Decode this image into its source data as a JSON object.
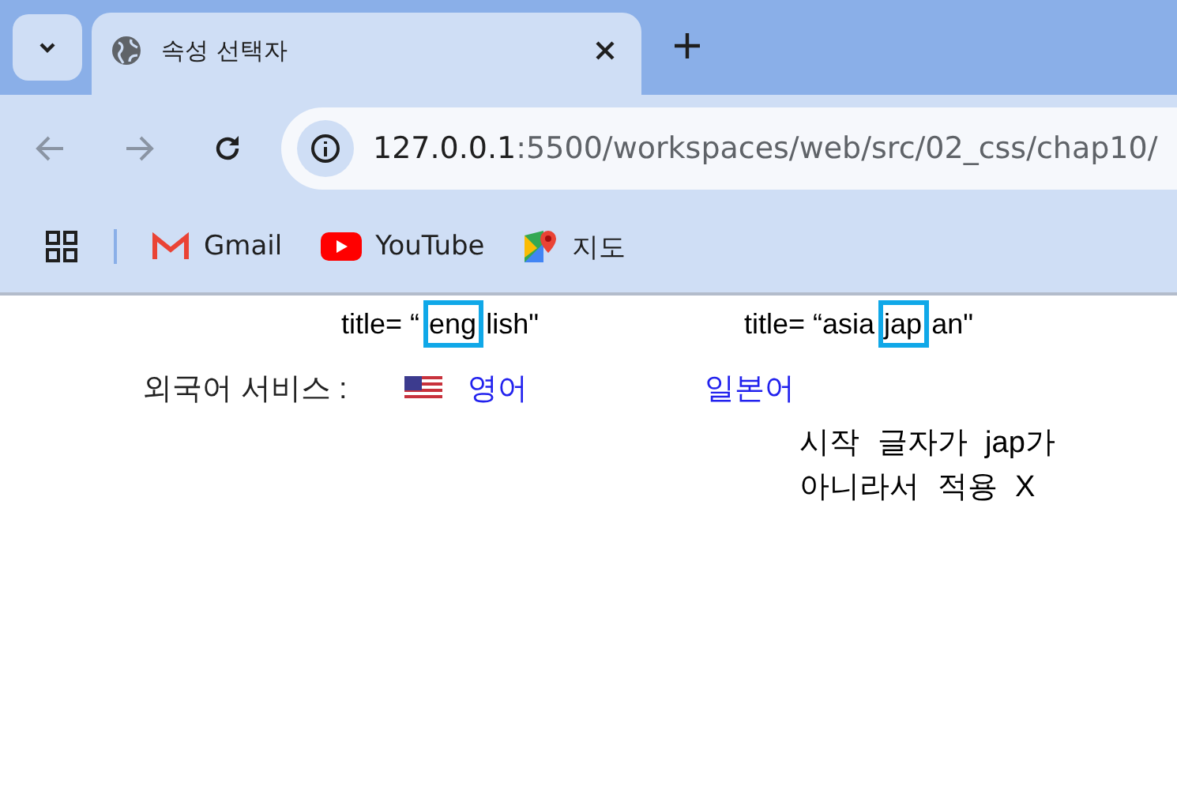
{
  "tab": {
    "title": "속성 선택자"
  },
  "address_bar": {
    "host": "127.0.0.1",
    "path": ":5500/workspaces/web/src/02_css/chap10/"
  },
  "bookmarks": [
    {
      "label": "Gmail",
      "kind": "gmail"
    },
    {
      "label": "YouTube",
      "kind": "youtube"
    },
    {
      "label": "지도",
      "kind": "maps"
    }
  ],
  "page": {
    "label": "외국어 서비스 :",
    "links": [
      {
        "label": "영어",
        "flag": true
      },
      {
        "label": "일본어",
        "flag": false
      }
    ]
  },
  "annotations": [
    {
      "prefix": "title= “",
      "highlight": "eng",
      "suffix": "lish\""
    },
    {
      "prefix": "title= “asia",
      "highlight": "jap",
      "suffix": "an\""
    }
  ],
  "note": [
    "시작 글자가 jap가",
    "아니라서 적용 X"
  ]
}
